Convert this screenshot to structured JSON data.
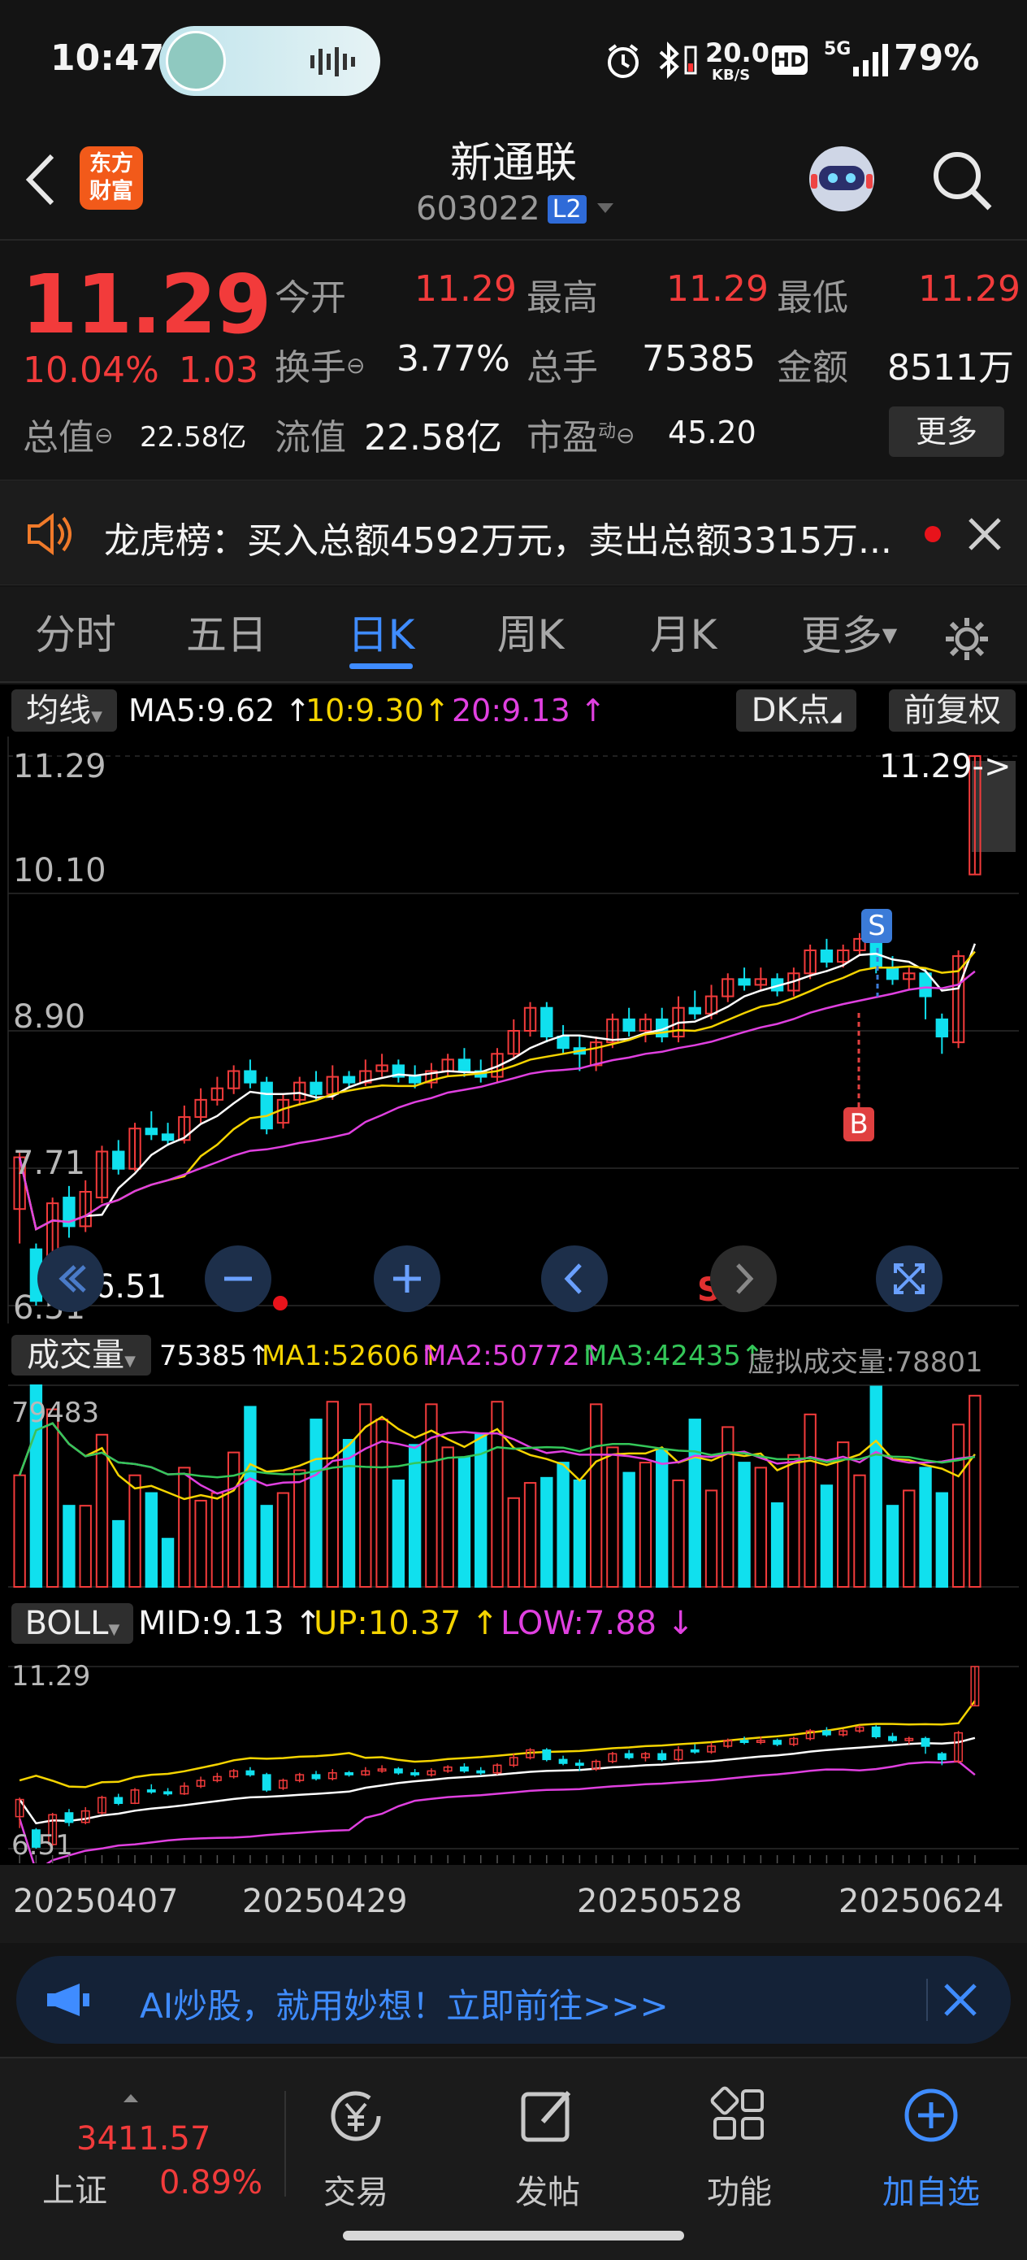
{
  "status_bar": {
    "time": "10:47",
    "net_speed_value": "20.0",
    "net_speed_unit": "KB/S",
    "hd_badge": "HD",
    "signal_label": "5G",
    "battery": "79%"
  },
  "header": {
    "brand_line1": "东方",
    "brand_line2": "财富",
    "title": "新通联",
    "code": "603022",
    "level_badge": "L2"
  },
  "quote": {
    "price": "11.29",
    "change_pct": "10.04%",
    "change_amt": "1.03",
    "fields": [
      {
        "label": "今开",
        "value": "11.29",
        "red": true
      },
      {
        "label": "最高",
        "value": "11.29",
        "red": true
      },
      {
        "label": "最低",
        "value": "11.29",
        "red": true
      },
      {
        "label": "换手",
        "value": "3.77%",
        "red": false
      },
      {
        "label": "总手",
        "value": "75385",
        "red": false
      },
      {
        "label": "金额",
        "value": "8511万",
        "red": false
      },
      {
        "label": "总值",
        "value": "22.58亿",
        "red": false
      },
      {
        "label": "流值",
        "value": "22.58亿",
        "red": false
      },
      {
        "label": "市盈",
        "value": "45.20",
        "red": false
      }
    ],
    "pe_sup": "动",
    "more_button": "更多"
  },
  "notice": {
    "text": "龙虎榜：买入总额4592万元，卖出总额3315万..."
  },
  "tabs": [
    "分时",
    "五日",
    "日K",
    "周K",
    "月K",
    "更多"
  ],
  "active_tab": 2,
  "kline_panel": {
    "indicator_select": "均线",
    "ma5": "MA5:9.62",
    "ma10": "10:9.30",
    "ma20": "20:9.13",
    "dk_button": "DK点",
    "adjust_button": "前复权",
    "price_labels": [
      "11.29",
      "10.10",
      "8.90",
      "7.71",
      "6.51"
    ],
    "last_price_marker": "11.29->",
    "low_price_marker": "<-6.51",
    "signal_s": "S",
    "signal_b": "B",
    "signal_s_bottom": "S"
  },
  "volume_panel": {
    "indicator_select": "成交量",
    "vol": "75385",
    "ma1": "MA1:52606",
    "ma2": "MA2:50772",
    "ma3": "MA3:42435",
    "virtual": "虚拟成交量:78801",
    "max_label": "79483"
  },
  "boll_panel": {
    "indicator_select": "BOLL",
    "mid": "MID:9.13",
    "up": "UP:10.37",
    "low": "LOW:7.88",
    "top_label": "11.29",
    "bottom_label": "6.51"
  },
  "date_axis": [
    "20250407",
    "20250429",
    "20250528",
    "20250624"
  ],
  "chart_data": {
    "type": "candlestick",
    "price_range": [
      6.51,
      11.29
    ],
    "volume_max": 79483,
    "candles": [
      {
        "o": 7.35,
        "c": 7.8,
        "h": 7.85,
        "l": 7.05,
        "v": 44000
      },
      {
        "o": 7.0,
        "c": 6.55,
        "h": 7.05,
        "l": 6.51,
        "v": 79483
      },
      {
        "o": 6.62,
        "c": 7.4,
        "h": 7.45,
        "l": 6.58,
        "v": 70000
      },
      {
        "o": 7.45,
        "c": 7.2,
        "h": 7.55,
        "l": 7.1,
        "v": 32000
      },
      {
        "o": 7.2,
        "c": 7.5,
        "h": 7.6,
        "l": 7.15,
        "v": 32000
      },
      {
        "o": 7.45,
        "c": 7.85,
        "h": 7.9,
        "l": 7.4,
        "v": 60000
      },
      {
        "o": 7.85,
        "c": 7.7,
        "h": 7.95,
        "l": 7.65,
        "v": 26000
      },
      {
        "o": 7.7,
        "c": 8.05,
        "h": 8.1,
        "l": 7.68,
        "v": 44000
      },
      {
        "o": 8.05,
        "c": 8.0,
        "h": 8.2,
        "l": 7.95,
        "v": 37000
      },
      {
        "o": 8.0,
        "c": 7.95,
        "h": 8.1,
        "l": 7.9,
        "v": 19000
      },
      {
        "o": 7.95,
        "c": 8.15,
        "h": 8.25,
        "l": 7.92,
        "v": 47000
      },
      {
        "o": 8.15,
        "c": 8.3,
        "h": 8.4,
        "l": 8.1,
        "v": 34000
      },
      {
        "o": 8.3,
        "c": 8.4,
        "h": 8.5,
        "l": 8.25,
        "v": 37000
      },
      {
        "o": 8.4,
        "c": 8.55,
        "h": 8.6,
        "l": 8.35,
        "v": 53000
      },
      {
        "o": 8.55,
        "c": 8.45,
        "h": 8.65,
        "l": 8.4,
        "v": 71000
      },
      {
        "o": 8.45,
        "c": 8.05,
        "h": 8.5,
        "l": 8.0,
        "v": 32000
      },
      {
        "o": 8.1,
        "c": 8.3,
        "h": 8.35,
        "l": 8.05,
        "v": 37000
      },
      {
        "o": 8.3,
        "c": 8.45,
        "h": 8.5,
        "l": 8.25,
        "v": 46000
      },
      {
        "o": 8.45,
        "c": 8.35,
        "h": 8.55,
        "l": 8.3,
        "v": 66000
      },
      {
        "o": 8.35,
        "c": 8.5,
        "h": 8.6,
        "l": 8.3,
        "v": 73000
      },
      {
        "o": 8.5,
        "c": 8.45,
        "h": 8.55,
        "l": 8.4,
        "v": 58000
      },
      {
        "o": 8.45,
        "c": 8.55,
        "h": 8.65,
        "l": 8.42,
        "v": 72000
      },
      {
        "o": 8.55,
        "c": 8.6,
        "h": 8.7,
        "l": 8.5,
        "v": 66000
      },
      {
        "o": 8.6,
        "c": 8.5,
        "h": 8.65,
        "l": 8.45,
        "v": 42000
      },
      {
        "o": 8.5,
        "c": 8.45,
        "h": 8.6,
        "l": 8.4,
        "v": 56000
      },
      {
        "o": 8.45,
        "c": 8.55,
        "h": 8.62,
        "l": 8.4,
        "v": 72000
      },
      {
        "o": 8.55,
        "c": 8.65,
        "h": 8.7,
        "l": 8.5,
        "v": 55000
      },
      {
        "o": 8.65,
        "c": 8.55,
        "h": 8.75,
        "l": 8.5,
        "v": 51000
      },
      {
        "o": 8.55,
        "c": 8.5,
        "h": 8.65,
        "l": 8.45,
        "v": 60000
      },
      {
        "o": 8.5,
        "c": 8.7,
        "h": 8.75,
        "l": 8.45,
        "v": 73000
      },
      {
        "o": 8.7,
        "c": 8.9,
        "h": 9.0,
        "l": 8.65,
        "v": 35000
      },
      {
        "o": 8.9,
        "c": 9.1,
        "h": 9.15,
        "l": 8.85,
        "v": 41000
      },
      {
        "o": 9.1,
        "c": 8.85,
        "h": 9.15,
        "l": 8.8,
        "v": 43000
      },
      {
        "o": 8.85,
        "c": 8.75,
        "h": 8.95,
        "l": 8.7,
        "v": 49000
      },
      {
        "o": 8.75,
        "c": 8.7,
        "h": 8.85,
        "l": 8.55,
        "v": 42000
      },
      {
        "o": 8.6,
        "c": 8.8,
        "h": 8.85,
        "l": 8.55,
        "v": 72000
      },
      {
        "o": 8.8,
        "c": 9.0,
        "h": 9.05,
        "l": 8.75,
        "v": 55000
      },
      {
        "o": 9.0,
        "c": 8.9,
        "h": 9.1,
        "l": 8.85,
        "v": 45000
      },
      {
        "o": 8.9,
        "c": 9.0,
        "h": 9.05,
        "l": 8.8,
        "v": 49000
      },
      {
        "o": 9.0,
        "c": 8.85,
        "h": 9.1,
        "l": 8.8,
        "v": 54000
      },
      {
        "o": 8.85,
        "c": 9.1,
        "h": 9.2,
        "l": 8.8,
        "v": 42000
      },
      {
        "o": 9.1,
        "c": 9.05,
        "h": 9.25,
        "l": 9.0,
        "v": 66000
      },
      {
        "o": 9.05,
        "c": 9.2,
        "h": 9.3,
        "l": 9.0,
        "v": 38000
      },
      {
        "o": 9.2,
        "c": 9.35,
        "h": 9.4,
        "l": 9.15,
        "v": 63000
      },
      {
        "o": 9.35,
        "c": 9.3,
        "h": 9.45,
        "l": 9.25,
        "v": 49000
      },
      {
        "o": 9.3,
        "c": 9.35,
        "h": 9.45,
        "l": 9.25,
        "v": 47000
      },
      {
        "o": 9.35,
        "c": 9.25,
        "h": 9.4,
        "l": 9.2,
        "v": 33000
      },
      {
        "o": 9.25,
        "c": 9.4,
        "h": 9.45,
        "l": 9.2,
        "v": 52000
      },
      {
        "o": 9.4,
        "c": 9.6,
        "h": 9.65,
        "l": 9.35,
        "v": 68000
      },
      {
        "o": 9.6,
        "c": 9.5,
        "h": 9.7,
        "l": 9.45,
        "v": 40000
      },
      {
        "o": 9.5,
        "c": 9.6,
        "h": 9.65,
        "l": 9.45,
        "v": 57000
      },
      {
        "o": 9.6,
        "c": 9.7,
        "h": 9.75,
        "l": 9.55,
        "v": 44000
      },
      {
        "o": 9.7,
        "c": 9.45,
        "h": 9.75,
        "l": 9.4,
        "v": 79000
      },
      {
        "o": 9.45,
        "c": 9.35,
        "h": 9.55,
        "l": 9.3,
        "v": 32000
      },
      {
        "o": 9.35,
        "c": 9.4,
        "h": 9.45,
        "l": 9.25,
        "v": 38000
      },
      {
        "o": 9.4,
        "c": 9.2,
        "h": 9.45,
        "l": 9.0,
        "v": 47000
      },
      {
        "o": 9.0,
        "c": 8.85,
        "h": 9.05,
        "l": 8.7,
        "v": 37000
      },
      {
        "o": 8.8,
        "c": 9.55,
        "h": 9.6,
        "l": 8.75,
        "v": 64000
      },
      {
        "o": 10.26,
        "c": 11.29,
        "h": 11.29,
        "l": 10.26,
        "v": 75385
      }
    ]
  },
  "ai_banner": {
    "text": "AI炒股，就用妙想！立即前往>>>"
  },
  "bottom_nav": {
    "index_value": "3411.57",
    "index_name": "上证",
    "index_change": "0.89%",
    "items": [
      "交易",
      "发帖",
      "功能",
      "加自选"
    ]
  },
  "colors": {
    "up": "#f23b3b",
    "down": "#10e0ee",
    "accent": "#3f8cff",
    "ma5": "#ffffff",
    "ma10": "#f5d400",
    "ma20": "#e040e0"
  }
}
